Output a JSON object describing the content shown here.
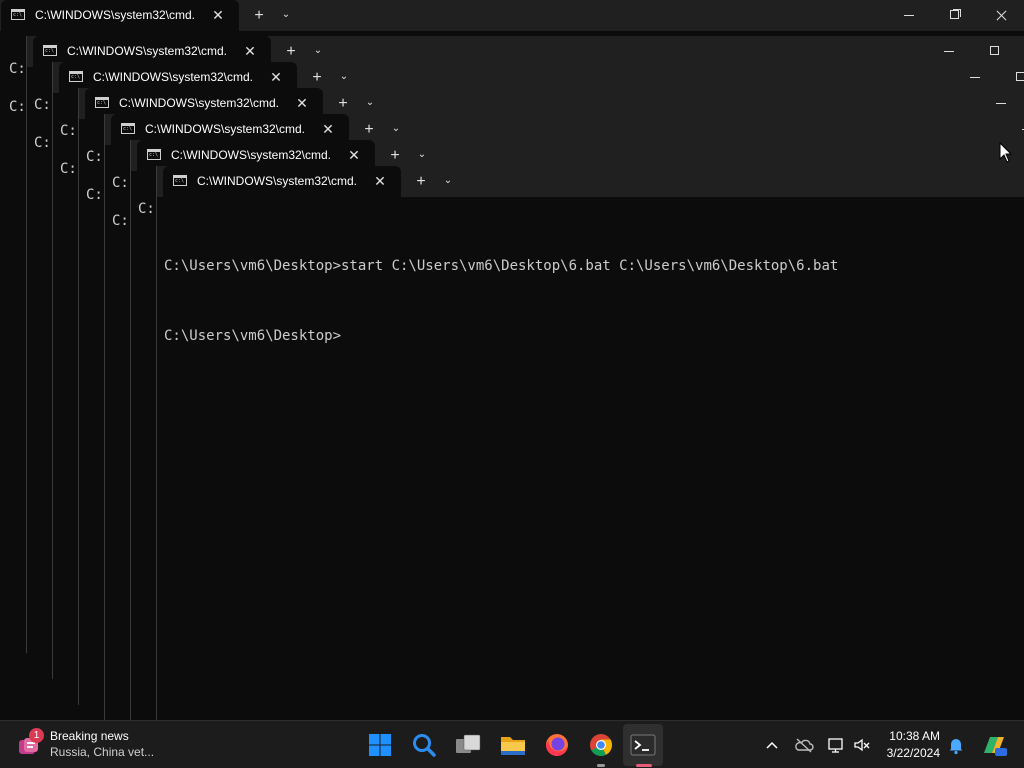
{
  "window_title": "C:\\WINDOWS\\system32\\cmd.",
  "tab_close_glyph": "✕",
  "tab_new_glyph": "+",
  "tab_dropdown_glyph": "⌄",
  "background_prompt_fragment": "C:",
  "console": {
    "lines": [
      "C:\\Users\\vm6\\Desktop>start C:\\Users\\vm6\\Desktop\\6.bat C:\\Users\\vm6\\Desktop\\6.bat",
      "C:\\Users\\vm6\\Desktop>"
    ]
  },
  "taskbar": {
    "news": {
      "badge": "1",
      "title": "Breaking news",
      "subtitle": "Russia, China vet..."
    },
    "apps": [
      "start-icon",
      "search-icon",
      "task-view-icon",
      "file-explorer-icon",
      "firefox-icon",
      "chrome-icon",
      "terminal-icon"
    ],
    "tray": [
      "show-hidden-icons-icon",
      "onedrive-icon",
      "network-icon",
      "volume-icon",
      "notifications-icon",
      "copilot-icon"
    ],
    "clock": {
      "time": "10:38 AM",
      "date": "3/22/2024"
    }
  },
  "colors": {
    "console_bg": "#0c0c0c",
    "titlebar_bg": "#202020",
    "console_text": "#cccccc",
    "taskbar_bg": "#1c1c1c",
    "windows_blue": "#1e90ff"
  }
}
